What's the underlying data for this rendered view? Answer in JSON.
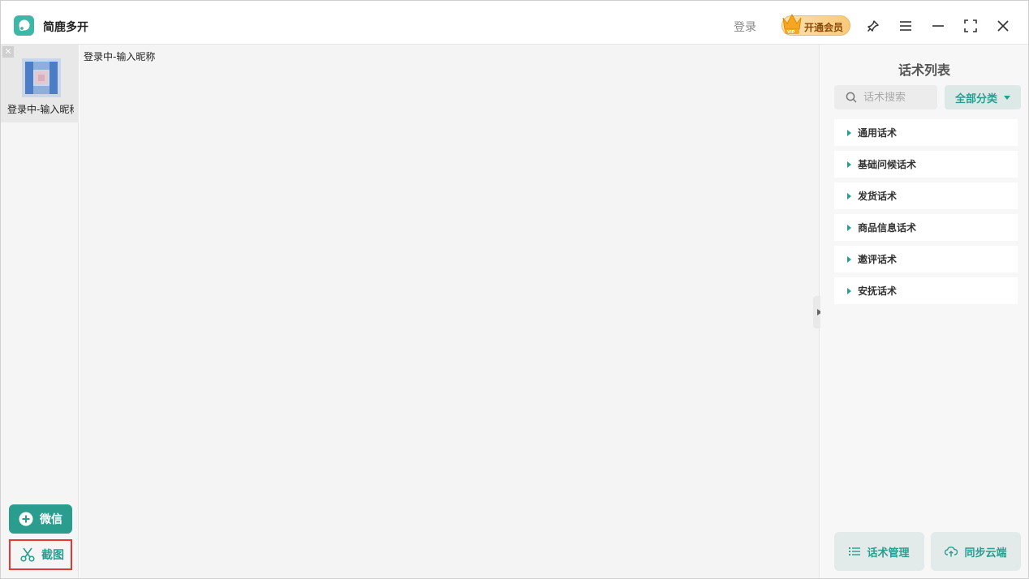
{
  "app": {
    "title": "简鹿多开",
    "login_label": "登录",
    "vip_label": "开通会员"
  },
  "sidebar": {
    "account": {
      "name": "登录中-输入昵称"
    },
    "add_wechat_label": "微信",
    "screenshot_label": "截图"
  },
  "main": {
    "status_text": "登录中-输入昵称"
  },
  "right_panel": {
    "title": "话术列表",
    "search_placeholder": "话术搜索",
    "category_label": "全部分类",
    "items": [
      {
        "label": "通用话术"
      },
      {
        "label": "基础问候话术"
      },
      {
        "label": "发货话术"
      },
      {
        "label": "商品信息话术"
      },
      {
        "label": "邀评话术"
      },
      {
        "label": "安抚话术"
      }
    ],
    "manage_label": "话术管理",
    "sync_label": "同步云端"
  },
  "colors": {
    "accent": "#2a9d8f",
    "highlight_border": "#e53935",
    "vip_gold": "#f8c97a"
  },
  "icons": [
    "app-logo",
    "crown-icon",
    "pin-icon",
    "menu-icon",
    "minimize-icon",
    "maximize-icon",
    "close-icon",
    "plus-circle-icon",
    "scissors-icon",
    "search-icon",
    "list-icon",
    "cloud-upload-icon"
  ]
}
